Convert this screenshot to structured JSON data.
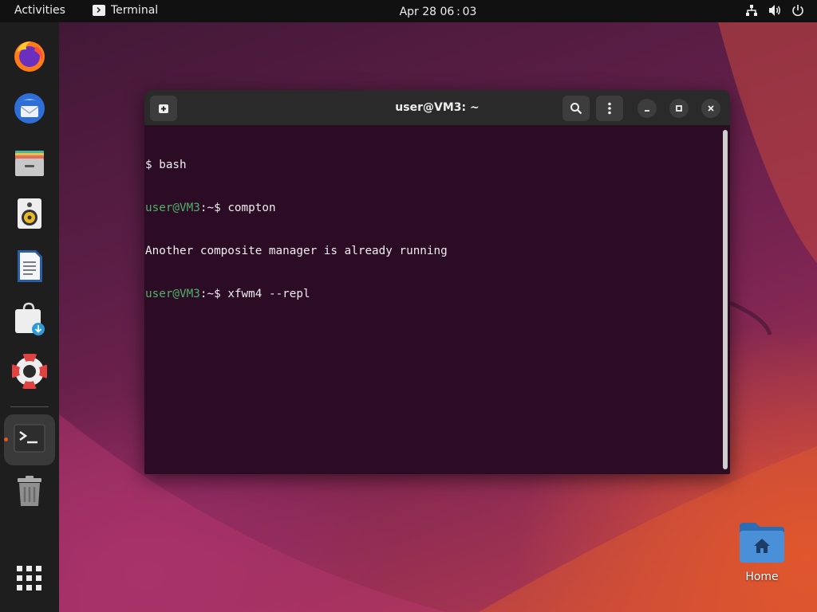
{
  "topbar": {
    "activities": "Activities",
    "app_name": "Terminal",
    "clock": "Apr 28  06 : 03",
    "tray_icons": [
      "network-icon",
      "volume-icon",
      "power-icon"
    ]
  },
  "dock": {
    "items": [
      {
        "name": "firefox",
        "icon": "firefox-icon"
      },
      {
        "name": "thunderbird",
        "icon": "thunderbird-icon"
      },
      {
        "name": "files",
        "icon": "files-icon"
      },
      {
        "name": "rhythmbox",
        "icon": "rhythmbox-icon"
      },
      {
        "name": "libreoffice-writer",
        "icon": "writer-icon"
      },
      {
        "name": "app-center",
        "icon": "app-center-icon"
      },
      {
        "name": "help",
        "icon": "help-icon"
      },
      {
        "name": "terminal",
        "icon": "terminal-icon",
        "active": true
      },
      {
        "name": "trash",
        "icon": "trash-icon"
      },
      {
        "name": "show-apps",
        "icon": "grid-icon"
      }
    ]
  },
  "terminal": {
    "title": "user@VM3: ~",
    "lines": [
      {
        "prompt": "",
        "text": "$ bash"
      },
      {
        "prompt": "user@VM3",
        "sep": ":~$ ",
        "text": "compton"
      },
      {
        "prompt": "",
        "text": "Another composite manager is already running"
      },
      {
        "prompt": "user@VM3",
        "sep": ":~$ ",
        "text": "xfwm4 --repl"
      }
    ]
  },
  "desktop": {
    "home_label": "Home"
  },
  "colors": {
    "accent": "#e95420",
    "terminal_bg": "#2c0b24",
    "prompt_green": "#4fb06a"
  }
}
